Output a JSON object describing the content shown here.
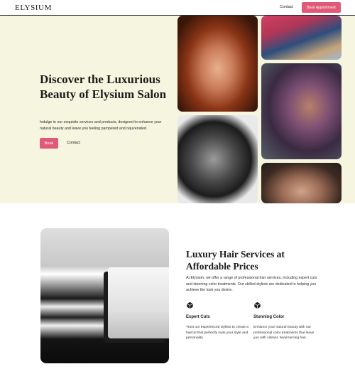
{
  "header": {
    "logo": "ELYSIUM",
    "nav_contact": "Contact",
    "book_button": "Book Appointment"
  },
  "hero": {
    "title": "Discover the Luxurious Beauty of Elysium Salon",
    "description": "Indulge in our exquisite services and products, designed to enhance your natural beauty and leave you feeling pampered and rejuvenated.",
    "book_label": "Book",
    "contact_label": "Contact"
  },
  "services": {
    "title": "Luxury Hair Services at Affordable Prices",
    "description": "At Elysium, we offer a range of professional hair services, including expert cuts and stunning color treatments. Our skilled stylists are dedicated to helping you achieve the look you desire.",
    "features": [
      {
        "icon": "cube-icon",
        "title": "Expert Cuts",
        "description": "Trust our experienced stylists to create a haircut that perfectly suits your style and personality."
      },
      {
        "icon": "cube-icon",
        "title": "Stunning Color",
        "description": "Enhance your natural beauty with our professional color treatments that leave you with vibrant, head-turning hair."
      }
    ]
  },
  "colors": {
    "accent": "#e05a78",
    "hero_bg": "#f6f5df"
  }
}
